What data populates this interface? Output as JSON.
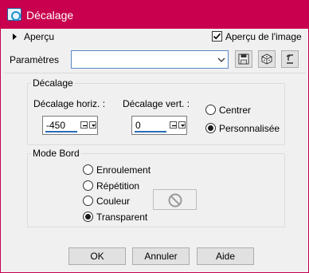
{
  "window": {
    "title": "Décalage"
  },
  "apercu": {
    "label": "Aperçu"
  },
  "apercu_image": {
    "label": "Aperçu de l'image",
    "checked": true
  },
  "parametres": {
    "label": "Paramètres",
    "value": ""
  },
  "decalage": {
    "group_label": "Décalage",
    "horiz_label": "Décalage horiz. :",
    "horiz_value": "-450",
    "vert_label": "Décalage vert. :",
    "vert_value": "0",
    "options": [
      {
        "label": "Centrer",
        "selected": false
      },
      {
        "label": "Personnalisée",
        "selected": true
      }
    ]
  },
  "mode_bord": {
    "group_label": "Mode Bord",
    "options": [
      {
        "label": "Enroulement",
        "selected": false
      },
      {
        "label": "Répétition",
        "selected": false
      },
      {
        "label": "Couleur",
        "selected": false
      },
      {
        "label": "Transparent",
        "selected": true
      }
    ],
    "color_icon": "no-color-icon"
  },
  "buttons": {
    "ok": "OK",
    "cancel": "Annuler",
    "help": "Aide"
  },
  "colors": {
    "titlebar": "#c8004d",
    "accent": "#2b6cb8"
  }
}
